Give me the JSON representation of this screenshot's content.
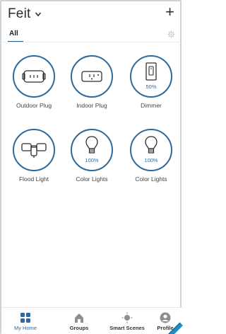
{
  "header": {
    "home_name": "Feit",
    "add_label": "+"
  },
  "tabs": {
    "active": "All"
  },
  "devices": [
    {
      "name": "Outdoor Plug",
      "icon": "outdoor-plug-icon",
      "level": ""
    },
    {
      "name": "Indoor Plug",
      "icon": "indoor-plug-icon",
      "level": ""
    },
    {
      "name": "Dimmer",
      "icon": "dimmer-switch-icon",
      "level": "50%"
    },
    {
      "name": "Flood Light",
      "icon": "flood-light-icon",
      "level": ""
    },
    {
      "name": "Color Lights",
      "icon": "bulb-icon",
      "level": "100%"
    },
    {
      "name": "Color Lights",
      "icon": "bulb-icon",
      "level": "100%"
    }
  ],
  "bottom_nav": [
    {
      "label": "My Home",
      "icon": "home-grid-icon",
      "active": true
    },
    {
      "label": "Groups",
      "icon": "house-icon",
      "active": false
    },
    {
      "label": "Smart Scenes",
      "icon": "sun-icon",
      "active": false
    },
    {
      "label": "Profile",
      "icon": "profile-icon",
      "active": false
    }
  ],
  "colors": {
    "accent": "#2e6a9c",
    "text": "#2b2f33",
    "border": "#cfd3d6"
  }
}
